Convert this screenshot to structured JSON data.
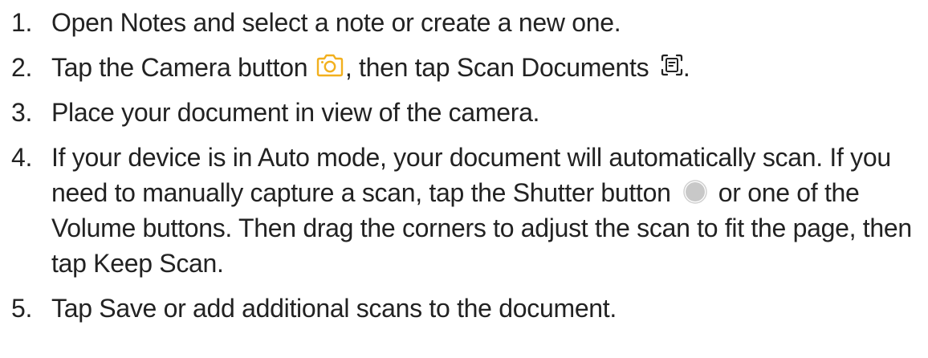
{
  "steps": [
    {
      "number": "1.",
      "text": "Open Notes and select a note or create a new one."
    },
    {
      "number": "2.",
      "text_before_camera": "Tap the Camera button ",
      "text_after_camera": ", then tap Scan Documents ",
      "text_end": ".",
      "camera_icon": "camera-icon",
      "scan_icon": "scan-document-icon"
    },
    {
      "number": "3.",
      "text": "Place your document in view of the camera."
    },
    {
      "number": "4.",
      "text_before_shutter": "If your device is in Auto mode, your document will automatically scan. If you need to manually capture a scan, tap the Shutter button ",
      "text_after_shutter": " or one of the Volume buttons. Then drag the corners to adjust the scan to fit the page, then tap Keep Scan.",
      "shutter_icon": "shutter-button-icon"
    },
    {
      "number": "5.",
      "text": "Tap Save or add additional scans to the document."
    }
  ],
  "colors": {
    "text": "#222222",
    "camera_icon": "#f2b01e",
    "shutter_icon": "#c8c8c8"
  }
}
